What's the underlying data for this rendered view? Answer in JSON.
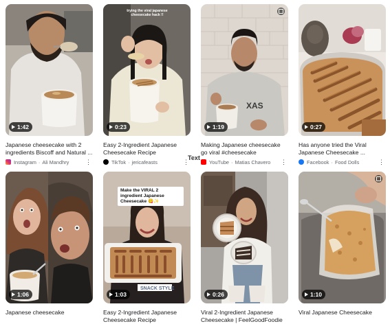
{
  "cards": [
    {
      "title": "Japanese cheesecake with 2 ingredients Biscoff and Natural ...",
      "source": "Instagram",
      "author": "Ali Mandhry",
      "duration": "1:42",
      "icon": "instagram-icon"
    },
    {
      "title": "Easy 2-Ingredient Japanese Cheesecake Recipe",
      "source": "TikTok",
      "author": "jericafeasts",
      "duration": "0:23",
      "icon": "tiktok-icon",
      "caption": "trying the viral japanese cheesecake hack !!"
    },
    {
      "title": "Making Japanese cheesecake go viral #cheesecake",
      "source": "YouTube",
      "author": "Matias Chavero",
      "duration": "1:19",
      "icon": "youtube-icon"
    },
    {
      "title": "Has anyone tried the Viral Japanese Cheesecake ...",
      "source": "Facebook",
      "author": "Food Dolls",
      "duration": "0:27",
      "icon": "facebook-icon"
    },
    {
      "title": "Japanese cheesecake",
      "duration": "1:06"
    },
    {
      "title": "Easy 2-Ingredient Japanese Cheesecake Recipe",
      "duration": "1:03",
      "sticker": "Make the VIRAL 2 ingredient Japanese Cheesecake 😋✨"
    },
    {
      "title": "Viral 2-Ingredient Japanese Cheesecake | FeelGoodFoodie",
      "duration": "0:26"
    },
    {
      "title": "Viral Japanese Cheesecake",
      "duration": "1:10"
    }
  ],
  "text_badge": "Text"
}
